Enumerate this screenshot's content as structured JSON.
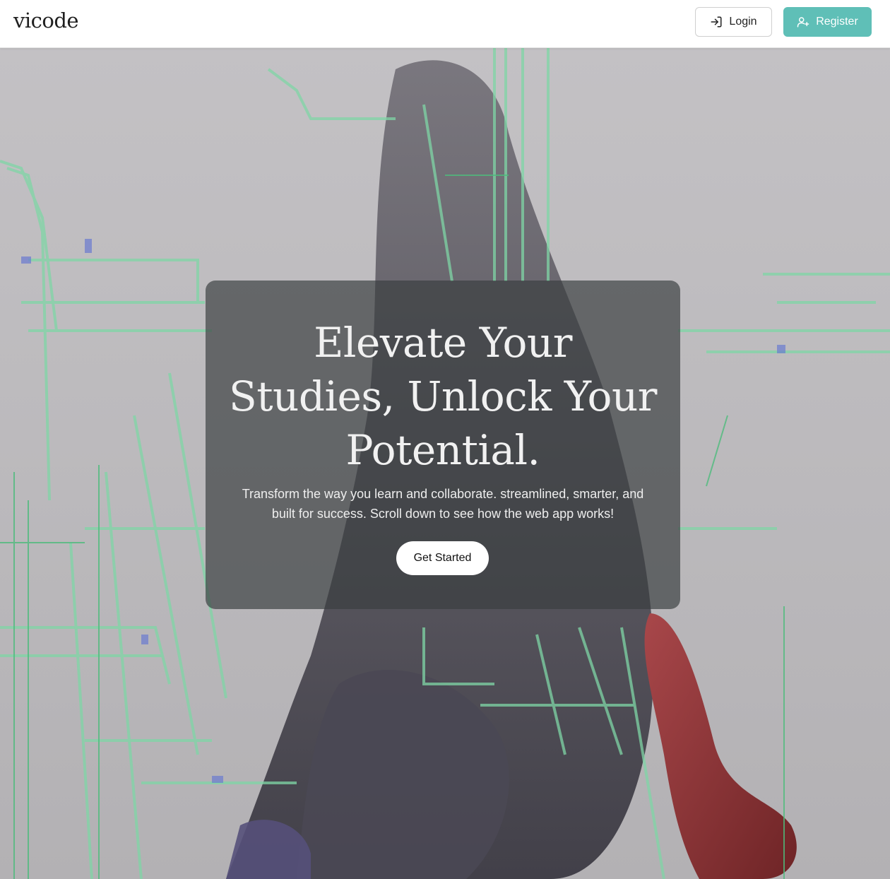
{
  "navbar": {
    "brand": "vicode",
    "login_label": "Login",
    "register_label": "Register"
  },
  "hero": {
    "headline": "Elevate Your Studies, Unlock Your Potential.",
    "subtitle": "Transform the way you learn and collaborate. streamlined, smarter, and built for success. Scroll down to see how the web app works!",
    "cta_label": "Get Started"
  },
  "icons": {
    "login": "login-icon",
    "register": "add-user-icon"
  },
  "colors": {
    "accent": "#5fbfb7",
    "card_overlay": "#3a3e40",
    "hero_background": "#bdbbbd"
  }
}
